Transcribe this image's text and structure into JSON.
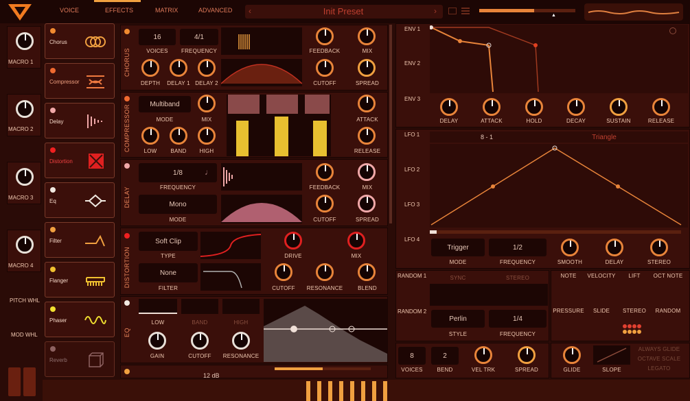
{
  "header": {
    "tabs": [
      "VOICE",
      "EFFECTS",
      "MATRIX",
      "ADVANCED"
    ],
    "preset": "Init Preset"
  },
  "macros": [
    "MACRO 1",
    "MACRO 2",
    "MACRO 3",
    "MACRO 4"
  ],
  "wheels": {
    "pitch": "PITCH WHL",
    "mod": "MOD WHL"
  },
  "fx": [
    {
      "name": "Chorus",
      "dot": "#f08a30"
    },
    {
      "name": "Compressor",
      "dot": "#f06a30"
    },
    {
      "name": "Delay",
      "dot": "#f0a8a8"
    },
    {
      "name": "Distortion",
      "dot": "#f02020"
    },
    {
      "name": "Eq",
      "dot": "#f0e8e0"
    },
    {
      "name": "Filter",
      "dot": "#f0a040"
    },
    {
      "name": "Flanger",
      "dot": "#f0c030"
    },
    {
      "name": "Phaser",
      "dot": "#f0e030"
    },
    {
      "name": "Reverb",
      "dot": "#b08080"
    }
  ],
  "chorus": {
    "title": "CHORUS",
    "voices": "16",
    "frequency": "4/1",
    "labels": {
      "voices": "VOICES",
      "frequency": "FREQUENCY",
      "feedback": "FEEDBACK",
      "mix": "MIX",
      "depth": "DEPTH",
      "delay1": "DELAY 1",
      "delay2": "DELAY 2",
      "cutoff": "CUTOFF",
      "spread": "SPREAD"
    }
  },
  "compressor": {
    "title": "COMPRESSOR",
    "mode": "Multiband",
    "labels": {
      "mode": "MODE",
      "mix": "MIX",
      "low": "LOW",
      "band": "BAND",
      "high": "HIGH",
      "attack": "ATTACK",
      "release": "RELEASE"
    }
  },
  "delay": {
    "title": "DELAY",
    "frequency": "1/8",
    "mode": "Mono",
    "labels": {
      "frequency": "FREQUENCY",
      "mode": "MODE",
      "feedback": "FEEDBACK",
      "mix": "MIX",
      "cutoff": "CUTOFF",
      "spread": "SPREAD"
    }
  },
  "distortion": {
    "title": "DISTORTION",
    "type": "Soft Clip",
    "filter": "None",
    "labels": {
      "type": "TYPE",
      "filter": "FILTER",
      "drive": "DRIVE",
      "mix": "MIX",
      "cutoff": "CUTOFF",
      "resonance": "RESONANCE",
      "blend": "BLEND"
    }
  },
  "eq": {
    "title": "EQ",
    "bands": [
      "LOW",
      "BAND",
      "HIGH"
    ],
    "labels": {
      "gain": "GAIN",
      "cutoff": "CUTOFF",
      "resonance": "RESONANCE"
    }
  },
  "env": {
    "labels": [
      "ENV 1",
      "ENV 2",
      "ENV 3"
    ],
    "knobs": [
      "DELAY",
      "ATTACK",
      "HOLD",
      "DECAY",
      "SUSTAIN",
      "RELEASE"
    ]
  },
  "lfo": {
    "labels": [
      "LFO 1",
      "LFO 2",
      "LFO 3",
      "LFO 4"
    ],
    "shape": "Triangle",
    "ratio": "8 - 1",
    "mode": "Trigger",
    "frequency": "1/2",
    "knobs": {
      "mode": "MODE",
      "frequency": "FREQUENCY",
      "smooth": "SMOOTH",
      "delay": "DELAY",
      "stereo": "STEREO"
    }
  },
  "random": {
    "labels": [
      "RANDOM 1",
      "RANDOM 2"
    ],
    "sync": "SYNC",
    "stereo": "STEREO",
    "style": "Perlin",
    "frequency": "1/4",
    "style_label": "STYLE",
    "freq_label": "FREQUENCY"
  },
  "sources": [
    "NOTE",
    "VELOCITY",
    "LIFT",
    "OCT NOTE",
    "PRESSURE",
    "SLIDE",
    "STEREO",
    "RANDOM"
  ],
  "voice": {
    "voices": "8",
    "bend": "2",
    "labels": {
      "voices": "VOICES",
      "bend": "BEND",
      "veltrk": "VEL TRK",
      "spread": "SPREAD",
      "glide": "GLIDE",
      "slope": "SLOPE"
    },
    "toggles": [
      "ALWAYS GLIDE",
      "OCTAVE SCALE",
      "LEGATO"
    ]
  },
  "bottom": {
    "db": "12 dB"
  }
}
